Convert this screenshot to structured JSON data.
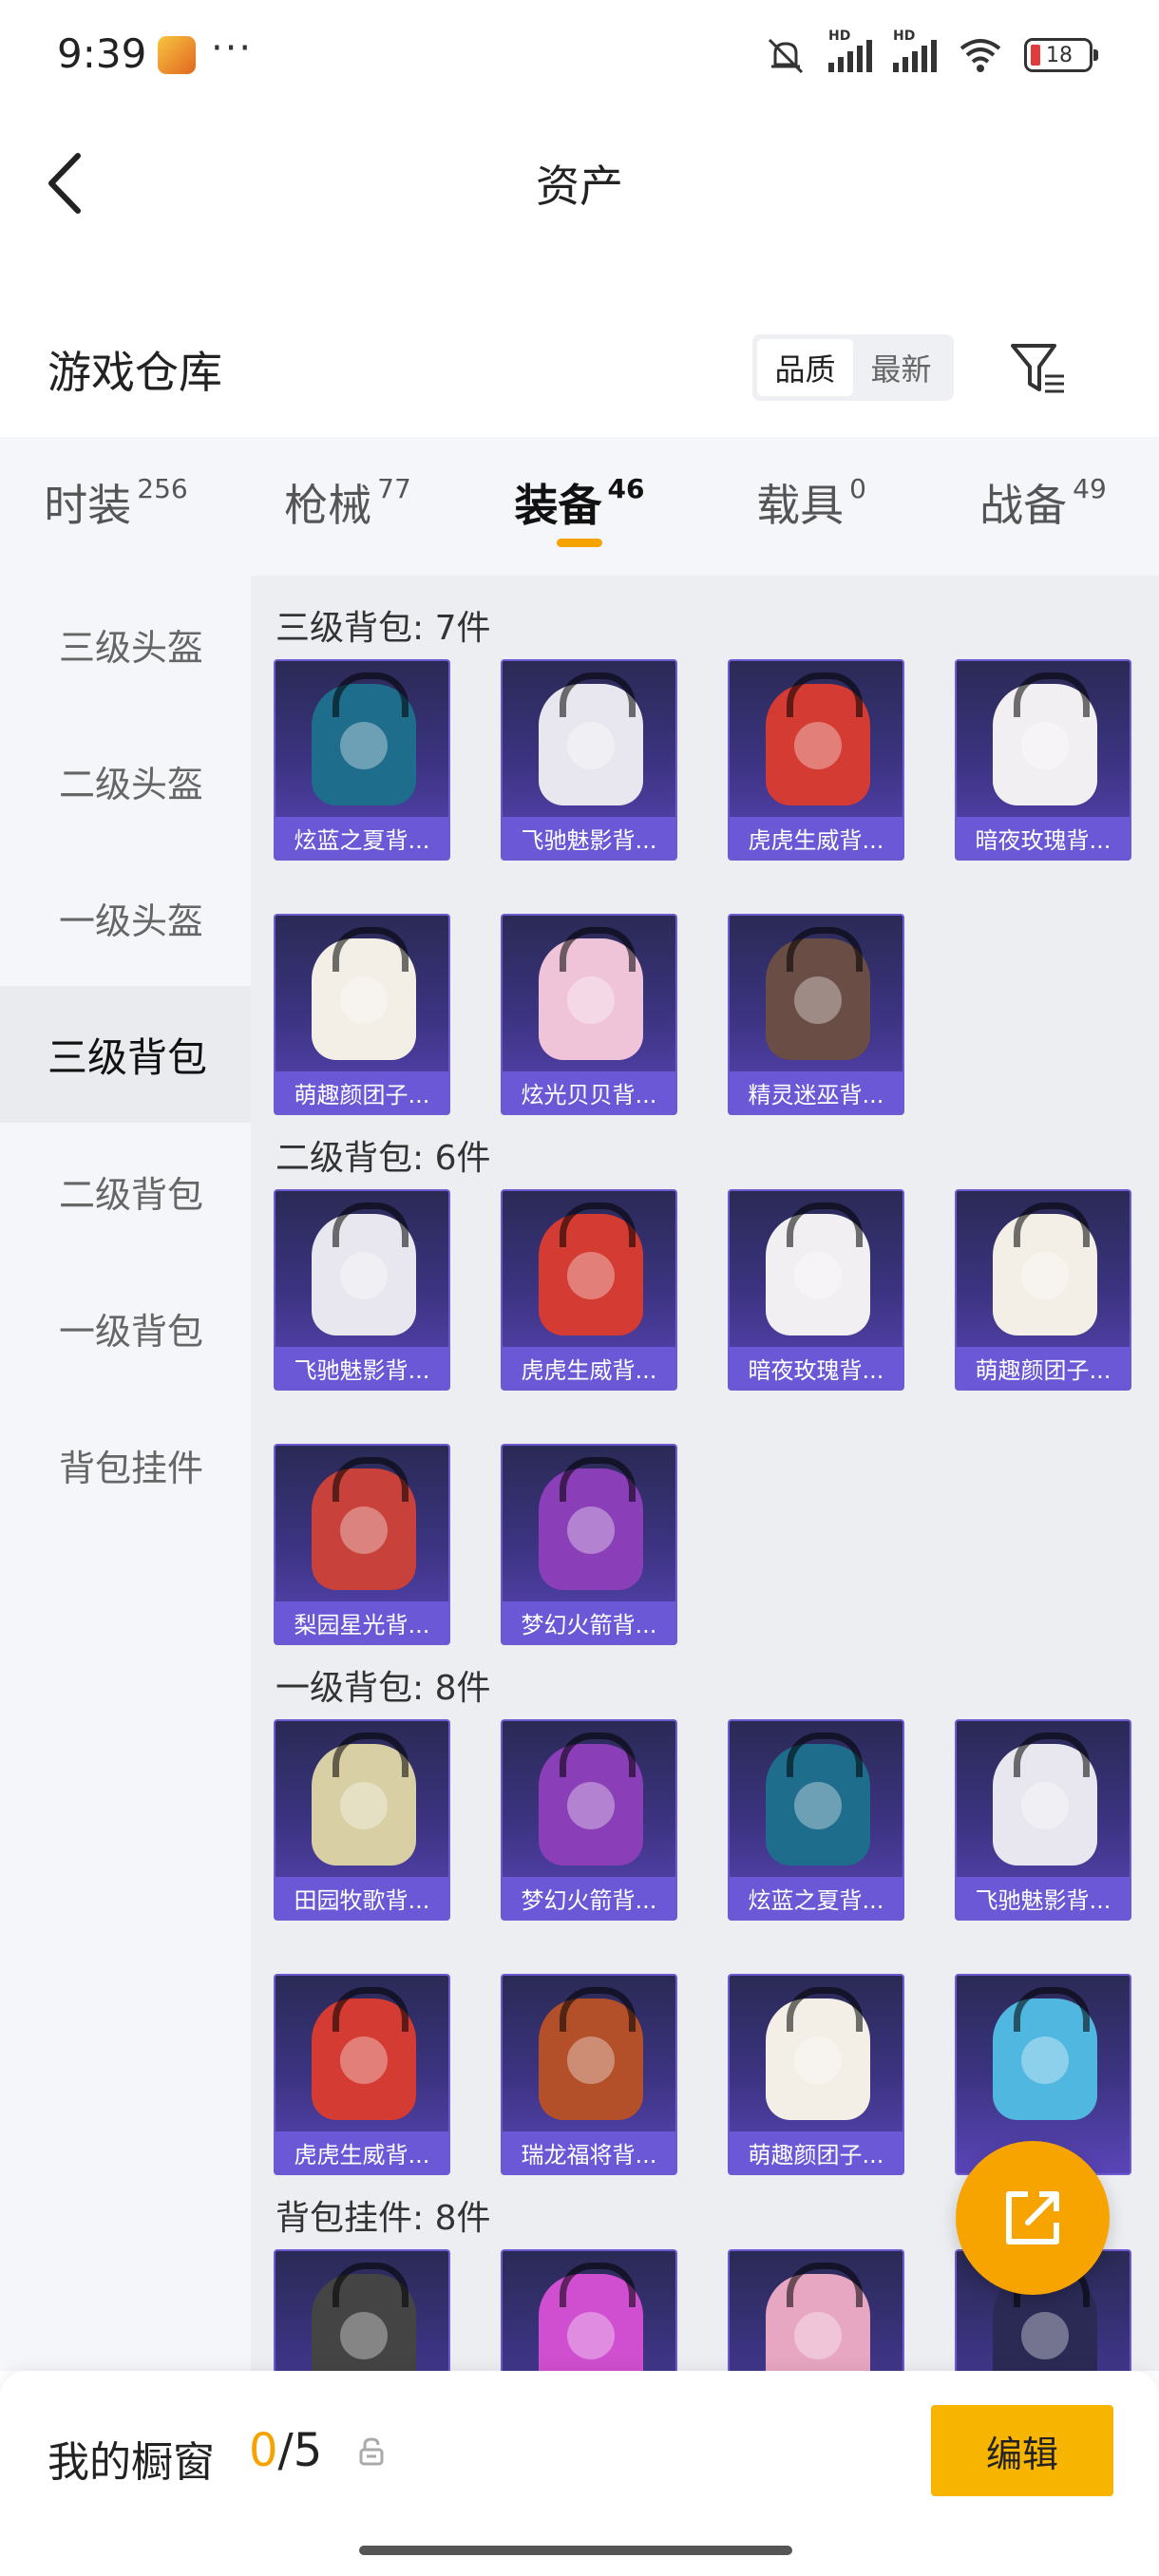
{
  "status_bar": {
    "time": "9:39",
    "more": "···",
    "battery": "18"
  },
  "nav": {
    "title": "资产"
  },
  "header": {
    "title": "游戏仓库",
    "sort": [
      {
        "label": "品质",
        "active": true
      },
      {
        "label": "最新",
        "active": false
      }
    ]
  },
  "tabs": [
    {
      "label": "时装",
      "count": "256",
      "active": false
    },
    {
      "label": "枪械",
      "count": "77",
      "active": false
    },
    {
      "label": "装备",
      "count": "46",
      "active": true
    },
    {
      "label": "载具",
      "count": "0",
      "active": false
    },
    {
      "label": "战备",
      "count": "49",
      "active": false
    }
  ],
  "sidebar": [
    {
      "label": "三级头盔",
      "active": false
    },
    {
      "label": "二级头盔",
      "active": false
    },
    {
      "label": "一级头盔",
      "active": false
    },
    {
      "label": "三级背包",
      "active": true
    },
    {
      "label": "二级背包",
      "active": false
    },
    {
      "label": "一级背包",
      "active": false
    },
    {
      "label": "背包挂件",
      "active": false
    }
  ],
  "sections": [
    {
      "title": "三级背包: 7件",
      "items": [
        {
          "name": "炫蓝之夏背...",
          "color": "#1f6d8c"
        },
        {
          "name": "飞驰魅影背...",
          "color": "#e8e6ef"
        },
        {
          "name": "虎虎生威背...",
          "color": "#d43b32"
        },
        {
          "name": "暗夜玫瑰背...",
          "color": "#f2eff2"
        },
        {
          "name": "萌趣颜团子...",
          "color": "#f3efe6"
        },
        {
          "name": "炫光贝贝背...",
          "color": "#f0c4d8"
        },
        {
          "name": "精灵迷巫背...",
          "color": "#6a4d44"
        }
      ]
    },
    {
      "title": "二级背包: 6件",
      "items": [
        {
          "name": "飞驰魅影背...",
          "color": "#e8e6ef"
        },
        {
          "name": "虎虎生威背...",
          "color": "#d43b32"
        },
        {
          "name": "暗夜玫瑰背...",
          "color": "#f2eff2"
        },
        {
          "name": "萌趣颜团子...",
          "color": "#f3efe6"
        },
        {
          "name": "梨园星光背...",
          "color": "#c8413a"
        },
        {
          "name": "梦幻火箭背...",
          "color": "#8a3fb8"
        }
      ]
    },
    {
      "title": "一级背包: 8件",
      "items": [
        {
          "name": "田园牧歌背...",
          "color": "#d8cfa4"
        },
        {
          "name": "梦幻火箭背...",
          "color": "#8a3fb8"
        },
        {
          "name": "炫蓝之夏背...",
          "color": "#1f6d8c"
        },
        {
          "name": "飞驰魅影背...",
          "color": "#e8e6ef"
        },
        {
          "name": "虎虎生威背...",
          "color": "#d43b32"
        },
        {
          "name": "瑞龙福将背...",
          "color": "#b3502a"
        },
        {
          "name": "萌趣颜团子...",
          "color": "#f3efe6"
        },
        {
          "name": "",
          "color": "#4fb7e0"
        }
      ]
    },
    {
      "title": "背包挂件: 8件",
      "items": [
        {
          "name": "",
          "color": "#444444"
        },
        {
          "name": "",
          "color": "#d04fd0"
        },
        {
          "name": "",
          "color": "#e7a6c2"
        },
        {
          "name": "",
          "color": "#2a2a55"
        }
      ]
    }
  ],
  "bottom_bar": {
    "label": "我的橱窗",
    "current": "0",
    "sep": "/",
    "max": "5",
    "edit_label": "编辑"
  }
}
